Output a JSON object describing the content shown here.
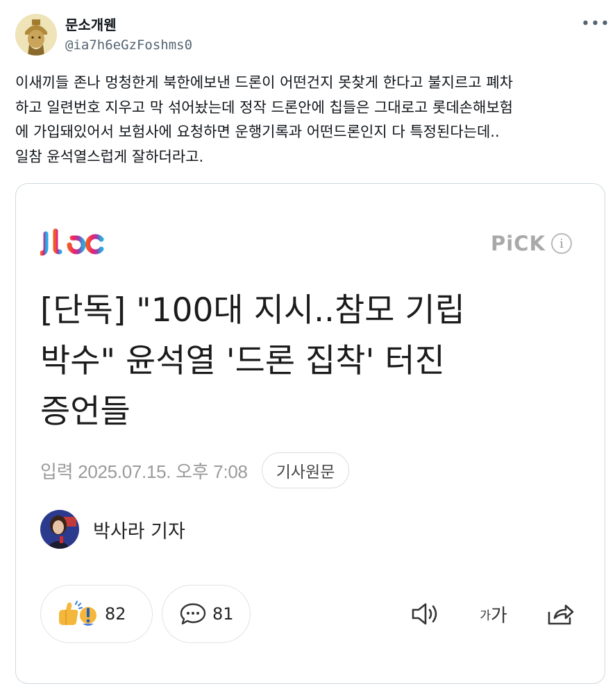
{
  "tweet": {
    "display_name": "문소개웬",
    "handle": "@ia7h6eGzFoshms0",
    "more_icon": "more-horizontal-icon",
    "text": "이새끼들 존나 멍청한게 북한에보낸 드론이 어떤건지 못찾게 한다고 불지르고 폐차\n하고 일련번호 지우고 막 섞어놨는데 정작 드론안에 칩들은 그대로고 롯데손해보험\n에 가입돼있어서 보험사에 요청하면 운행기록과 어떤드론인지 다 특정된다는데..\n일참 윤석열스럽게 잘하더라고."
  },
  "card": {
    "brand": "jtbc",
    "pick_label": "PiCK",
    "info_icon": "info-icon",
    "headline_lines": [
      "[단독] \"100대 지시..참모 기립",
      "박수\" 윤석열 '드론 집착' 터진",
      "증언들"
    ],
    "date": "입력 2025.07.15. 오후 7:08",
    "original_button": "기사원문",
    "reporter": "박사라 기자",
    "reactions_count": "82",
    "comments_count": "81",
    "font_small": "가",
    "font_large": "가",
    "icons": [
      "thumbs-up-emoji-icon",
      "surprise-emoji-icon",
      "comment-icon",
      "speaker-icon",
      "font-size-icon",
      "share-icon"
    ]
  },
  "colors": {
    "text": "#0f1419",
    "secondary": "#536471",
    "border": "#cfd9de",
    "jtbc_gradient": [
      "#f15a24",
      "#ed1e79",
      "#8e44ad",
      "#29abe2"
    ]
  }
}
